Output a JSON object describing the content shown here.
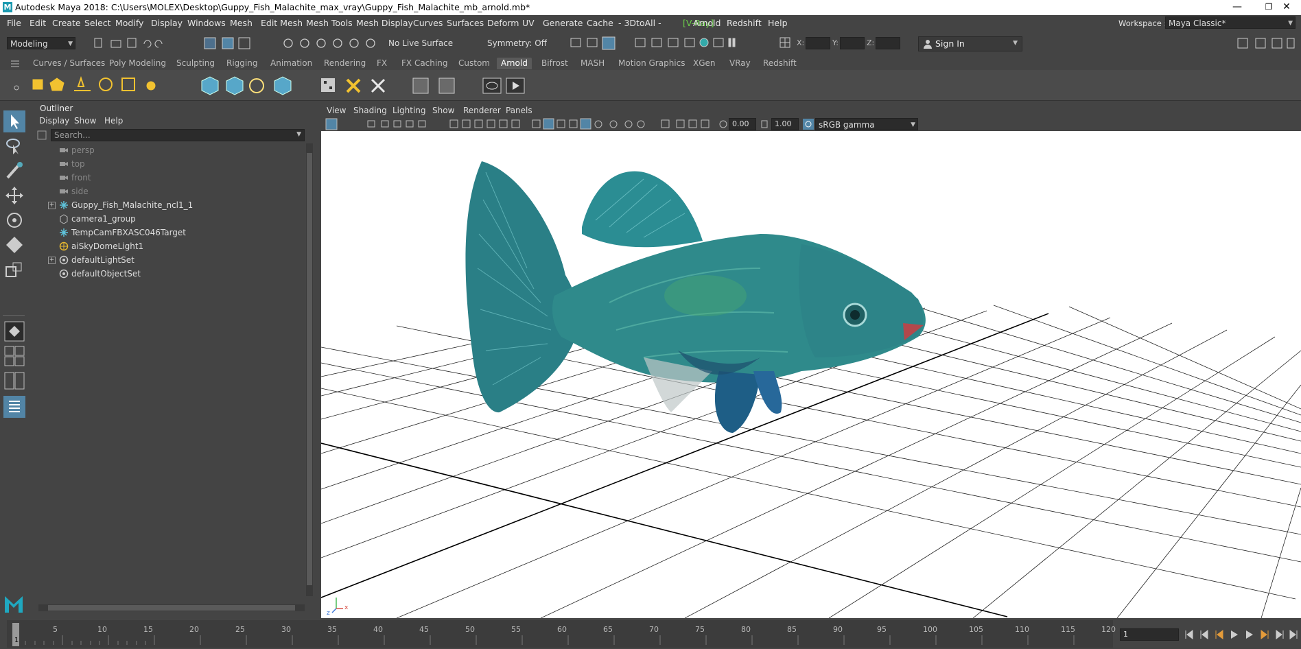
{
  "window": {
    "title": "Autodesk Maya 2018: C:\\Users\\MOLEX\\Desktop\\Guppy_Fish_Malachite_max_vray\\Guppy_Fish_Malachite_mb_arnold.mb*",
    "logo": "M",
    "minimize": "—",
    "restore": "❐",
    "close": "✕"
  },
  "menubar": {
    "items": [
      "File",
      "Edit",
      "Create",
      "Select",
      "Modify",
      "Display",
      "Windows",
      "Mesh",
      "Edit Mesh",
      "Mesh Tools",
      "Mesh Display",
      "Curves",
      "Surfaces",
      "Deform",
      "UV",
      "Generate",
      "Cache",
      "- 3DtoAll -",
      "[V-Ray]",
      "Arnold",
      "Redshift",
      "Help"
    ],
    "workspace_label": "Workspace :",
    "workspace_value": "Maya Classic*"
  },
  "statusline": {
    "menuset": "Modeling",
    "live_surface": "No Live Surface",
    "symmetry": "Symmetry: Off",
    "x_label": "X:",
    "y_label": "Y:",
    "z_label": "Z:",
    "sign_in": "Sign In"
  },
  "shelf": {
    "tabs": [
      "Curves / Surfaces",
      "Poly Modeling",
      "Sculpting",
      "Rigging",
      "Animation",
      "Rendering",
      "FX",
      "FX Caching",
      "Custom",
      "Arnold",
      "Bifrost",
      "MASH",
      "Motion Graphics",
      "XGen",
      "VRay",
      "Redshift"
    ],
    "active_tab": "Arnold"
  },
  "outliner": {
    "title": "Outliner",
    "menu": [
      "Display",
      "Show",
      "Help"
    ],
    "search_placeholder": "Search...",
    "items": [
      {
        "label": "persp",
        "icon": "camera-icon",
        "dim": true,
        "expandable": false
      },
      {
        "label": "top",
        "icon": "camera-icon",
        "dim": true,
        "expandable": false
      },
      {
        "label": "front",
        "icon": "camera-icon",
        "dim": true,
        "expandable": false
      },
      {
        "label": "side",
        "icon": "camera-icon",
        "dim": true,
        "expandable": false
      },
      {
        "label": "Guppy_Fish_Malachite_ncl1_1",
        "icon": "transform-icon",
        "dim": false,
        "expandable": true
      },
      {
        "label": "camera1_group",
        "icon": "group-icon",
        "dim": false,
        "expandable": false
      },
      {
        "label": "TempCamFBXASC046Target",
        "icon": "transform-icon",
        "dim": false,
        "expandable": false
      },
      {
        "label": "aiSkyDomeLight1",
        "icon": "skydome-light-icon",
        "dim": false,
        "expandable": false
      },
      {
        "label": "defaultLightSet",
        "icon": "set-icon",
        "dim": false,
        "expandable": true
      },
      {
        "label": "defaultObjectSet",
        "icon": "set-icon",
        "dim": false,
        "expandable": false
      }
    ]
  },
  "viewport": {
    "menu": [
      "View",
      "Shading",
      "Lighting",
      "Show",
      "Renderer",
      "Panels"
    ],
    "exposure": "0.00",
    "gamma": "1.00",
    "color_space": "sRGB gamma",
    "axis_x": "x",
    "axis_z": "z"
  },
  "timeslider": {
    "ticks": [
      "5",
      "10",
      "15",
      "20",
      "25",
      "30",
      "35",
      "40",
      "45",
      "50",
      "55",
      "60",
      "65",
      "70",
      "75",
      "80",
      "85",
      "90",
      "95",
      "100",
      "105",
      "110",
      "115",
      "120"
    ],
    "current_frame": "1",
    "frame_field": "1"
  },
  "colors": {
    "ui_bg": "#444444",
    "field_bg": "#2b2b2b",
    "accent": "#5285a6",
    "fish_teal": "#2e8b8c",
    "vray_green": "#6cd04a"
  }
}
